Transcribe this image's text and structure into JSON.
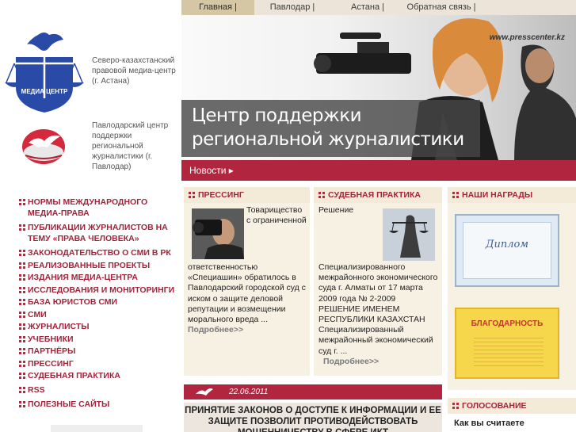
{
  "nav": {
    "items": [
      {
        "label": "Главная |"
      },
      {
        "label": "Павлодар |"
      },
      {
        "label": "Астана |"
      },
      {
        "label": "Обратная связь |"
      }
    ]
  },
  "logos": {
    "astana_text": "Северо-казахстанский правовой медиа-центр (г. Астана)",
    "pavlodar_text": "Павлодарский центр поддержки региональной журналистики (г. Павлодар)",
    "astana_logo_letters": "МЕДИА ЦЕНТР"
  },
  "banner": {
    "url": "www.presscenter.kz",
    "slogan_line1": "Центр поддержки",
    "slogan_line2": "региональной журналистики"
  },
  "newsbar": {
    "label": "Новости ▸"
  },
  "menu": {
    "items": [
      {
        "label": "НОРМЫ МЕЖДУНАРОДНОГО МЕДИА-ПРАВА"
      },
      {
        "label": "ПУБЛИКАЦИИ ЖУРНАЛИСТОВ НА ТЕМУ «ПРАВА ЧЕЛОВЕКА»"
      },
      {
        "label": "ЗАКОНОДАТЕЛЬСТВО О СМИ В РК"
      },
      {
        "label": "РЕАЛИЗОВАННЫЕ ПРОЕКТЫ"
      },
      {
        "label": "ИЗДАНИЯ МЕДИА-ЦЕНТРА"
      },
      {
        "label": "ИССЛЕДОВАНИЯ И МОНИТОРИНГИ"
      },
      {
        "label": "БАЗА ЮРИСТОВ СМИ"
      },
      {
        "label": "СМИ"
      },
      {
        "label": "ЖУРНАЛИСТЫ"
      },
      {
        "label": "УЧЕБНИКИ"
      },
      {
        "label": "ПАРТНЁРЫ"
      },
      {
        "label": "ПРЕССИНГ"
      },
      {
        "label": "СУДЕБНАЯ ПРАКТИКА"
      },
      {
        "label": "RSS"
      },
      {
        "label": "ПОЛЕЗНЫЕ САЙТЫ"
      }
    ]
  },
  "pressing": {
    "title": "ПРЕССИНГ",
    "text_side": "Товарищество с ограниченной",
    "text_rest": "ответственностью «Специашин» обратилось в Павлодарский городской суд с иском о защите деловой репутации и возмещении морального вреда ...",
    "more": "Подробнее>>"
  },
  "court": {
    "title": "СУДЕБНАЯ ПРАКТИКА",
    "text_side": "Решение",
    "text_rest": "Специализированного межрайонного экономического суда г. Алматы от 17 марта 2009 года № 2-2009 РЕШЕНИЕ ИМЕНЕМ РЕСПУБЛИКИ КАЗАХСТАН Специализированный межрайонный экономический суд г. ...",
    "more": "Подробнее>>"
  },
  "awards": {
    "title": "НАШИ НАГРАДЫ",
    "diploma_label": "Диплом",
    "gratitude_label": "БЛАГОДАРНОСТЬ"
  },
  "news2": {
    "date": "22.06.2011",
    "title": "ПРИНЯТИЕ ЗАКОНОВ О ДОСТУПЕ К ИНФОРМАЦИИ И ЕЕ ЗАЩИТЕ ПОЗВОЛИТ ПРОТИВОДЕЙСТВОВАТЬ МОШЕННИЧЕСТВУ В СФЕРЕ ИКТ"
  },
  "vote": {
    "title": "ГОЛОСОВАНИЕ",
    "question": "Как вы считаете"
  },
  "colors": {
    "accent": "#b1263e",
    "panel": "#f7f1e4",
    "panel_head": "#f3ead8",
    "nav_active": "#d6c7a4"
  }
}
